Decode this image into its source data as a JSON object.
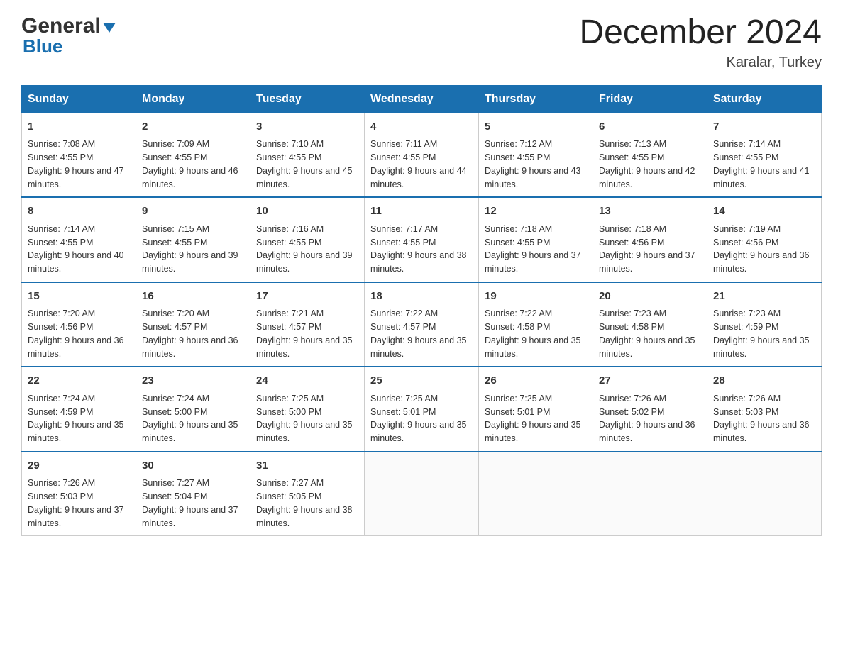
{
  "logo": {
    "line1_black": "General",
    "line1_blue_triangle": "▶",
    "line2": "Blue"
  },
  "title": "December 2024",
  "location": "Karalar, Turkey",
  "weekdays": [
    "Sunday",
    "Monday",
    "Tuesday",
    "Wednesday",
    "Thursday",
    "Friday",
    "Saturday"
  ],
  "weeks": [
    [
      {
        "day": "1",
        "sunrise": "7:08 AM",
        "sunset": "4:55 PM",
        "daylight": "9 hours and 47 minutes."
      },
      {
        "day": "2",
        "sunrise": "7:09 AM",
        "sunset": "4:55 PM",
        "daylight": "9 hours and 46 minutes."
      },
      {
        "day": "3",
        "sunrise": "7:10 AM",
        "sunset": "4:55 PM",
        "daylight": "9 hours and 45 minutes."
      },
      {
        "day": "4",
        "sunrise": "7:11 AM",
        "sunset": "4:55 PM",
        "daylight": "9 hours and 44 minutes."
      },
      {
        "day": "5",
        "sunrise": "7:12 AM",
        "sunset": "4:55 PM",
        "daylight": "9 hours and 43 minutes."
      },
      {
        "day": "6",
        "sunrise": "7:13 AM",
        "sunset": "4:55 PM",
        "daylight": "9 hours and 42 minutes."
      },
      {
        "day": "7",
        "sunrise": "7:14 AM",
        "sunset": "4:55 PM",
        "daylight": "9 hours and 41 minutes."
      }
    ],
    [
      {
        "day": "8",
        "sunrise": "7:14 AM",
        "sunset": "4:55 PM",
        "daylight": "9 hours and 40 minutes."
      },
      {
        "day": "9",
        "sunrise": "7:15 AM",
        "sunset": "4:55 PM",
        "daylight": "9 hours and 39 minutes."
      },
      {
        "day": "10",
        "sunrise": "7:16 AM",
        "sunset": "4:55 PM",
        "daylight": "9 hours and 39 minutes."
      },
      {
        "day": "11",
        "sunrise": "7:17 AM",
        "sunset": "4:55 PM",
        "daylight": "9 hours and 38 minutes."
      },
      {
        "day": "12",
        "sunrise": "7:18 AM",
        "sunset": "4:55 PM",
        "daylight": "9 hours and 37 minutes."
      },
      {
        "day": "13",
        "sunrise": "7:18 AM",
        "sunset": "4:56 PM",
        "daylight": "9 hours and 37 minutes."
      },
      {
        "day": "14",
        "sunrise": "7:19 AM",
        "sunset": "4:56 PM",
        "daylight": "9 hours and 36 minutes."
      }
    ],
    [
      {
        "day": "15",
        "sunrise": "7:20 AM",
        "sunset": "4:56 PM",
        "daylight": "9 hours and 36 minutes."
      },
      {
        "day": "16",
        "sunrise": "7:20 AM",
        "sunset": "4:57 PM",
        "daylight": "9 hours and 36 minutes."
      },
      {
        "day": "17",
        "sunrise": "7:21 AM",
        "sunset": "4:57 PM",
        "daylight": "9 hours and 35 minutes."
      },
      {
        "day": "18",
        "sunrise": "7:22 AM",
        "sunset": "4:57 PM",
        "daylight": "9 hours and 35 minutes."
      },
      {
        "day": "19",
        "sunrise": "7:22 AM",
        "sunset": "4:58 PM",
        "daylight": "9 hours and 35 minutes."
      },
      {
        "day": "20",
        "sunrise": "7:23 AM",
        "sunset": "4:58 PM",
        "daylight": "9 hours and 35 minutes."
      },
      {
        "day": "21",
        "sunrise": "7:23 AM",
        "sunset": "4:59 PM",
        "daylight": "9 hours and 35 minutes."
      }
    ],
    [
      {
        "day": "22",
        "sunrise": "7:24 AM",
        "sunset": "4:59 PM",
        "daylight": "9 hours and 35 minutes."
      },
      {
        "day": "23",
        "sunrise": "7:24 AM",
        "sunset": "5:00 PM",
        "daylight": "9 hours and 35 minutes."
      },
      {
        "day": "24",
        "sunrise": "7:25 AM",
        "sunset": "5:00 PM",
        "daylight": "9 hours and 35 minutes."
      },
      {
        "day": "25",
        "sunrise": "7:25 AM",
        "sunset": "5:01 PM",
        "daylight": "9 hours and 35 minutes."
      },
      {
        "day": "26",
        "sunrise": "7:25 AM",
        "sunset": "5:01 PM",
        "daylight": "9 hours and 35 minutes."
      },
      {
        "day": "27",
        "sunrise": "7:26 AM",
        "sunset": "5:02 PM",
        "daylight": "9 hours and 36 minutes."
      },
      {
        "day": "28",
        "sunrise": "7:26 AM",
        "sunset": "5:03 PM",
        "daylight": "9 hours and 36 minutes."
      }
    ],
    [
      {
        "day": "29",
        "sunrise": "7:26 AM",
        "sunset": "5:03 PM",
        "daylight": "9 hours and 37 minutes."
      },
      {
        "day": "30",
        "sunrise": "7:27 AM",
        "sunset": "5:04 PM",
        "daylight": "9 hours and 37 minutes."
      },
      {
        "day": "31",
        "sunrise": "7:27 AM",
        "sunset": "5:05 PM",
        "daylight": "9 hours and 38 minutes."
      },
      null,
      null,
      null,
      null
    ]
  ]
}
